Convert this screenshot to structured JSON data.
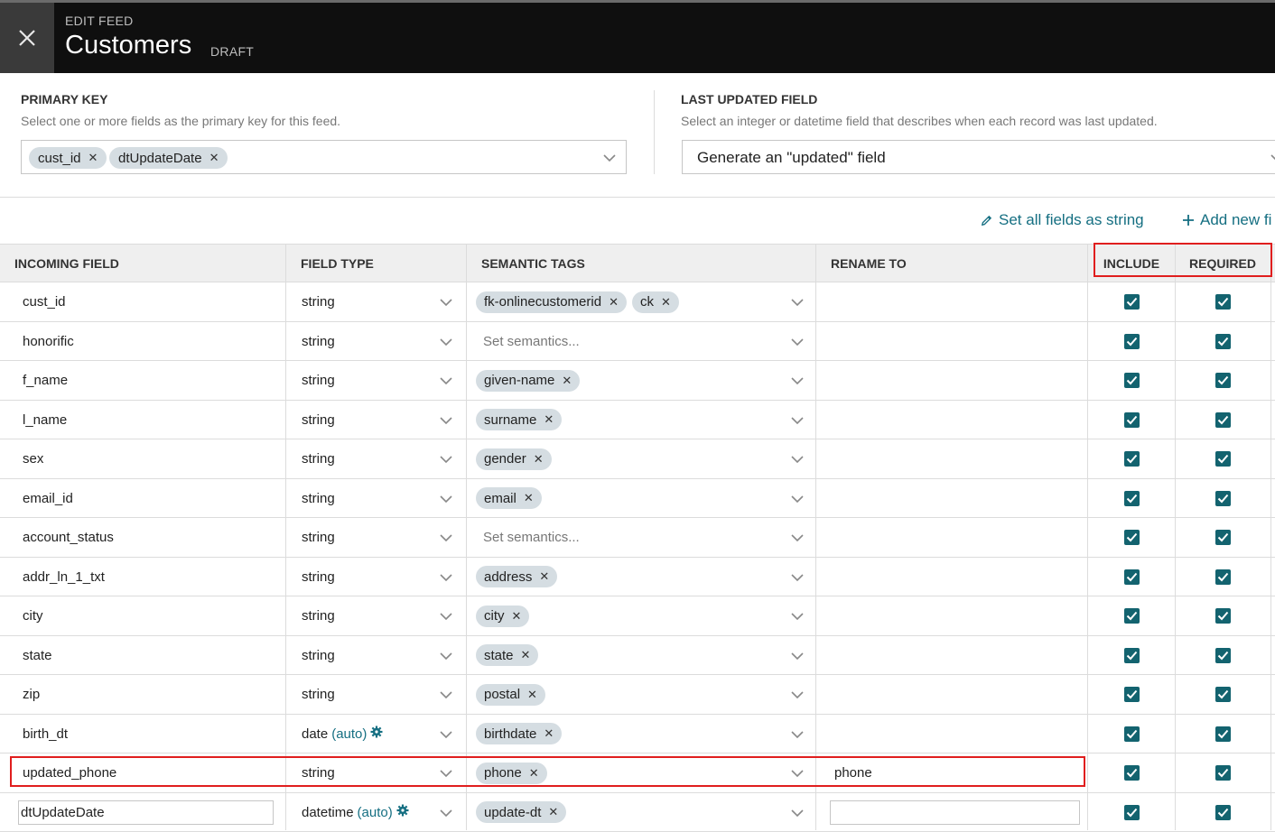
{
  "header": {
    "eyebrow": "EDIT FEED",
    "title": "Customers",
    "status": "DRAFT"
  },
  "primary_key": {
    "label": "PRIMARY KEY",
    "help": "Select one or more fields as the primary key for this feed.",
    "selected": [
      "cust_id",
      "dtUpdateDate"
    ]
  },
  "last_updated": {
    "label": "LAST UPDATED FIELD",
    "help": "Select an integer or datetime field that describes when each record was last updated.",
    "value": "Generate an \"updated\" field"
  },
  "actions": {
    "set_all_string": "Set all fields as string",
    "add_new": "Add new fi"
  },
  "table": {
    "columns": [
      "INCOMING FIELD",
      "FIELD TYPE",
      "SEMANTIC TAGS",
      "RENAME TO",
      "INCLUDE",
      "REQUIRED"
    ],
    "semantic_placeholder": "Set semantics...",
    "rows": [
      {
        "field": "cust_id",
        "type": "string",
        "auto": "",
        "tags": [
          "fk-onlinecustomerid",
          "ck"
        ],
        "rename": "",
        "include": true,
        "required": true
      },
      {
        "field": "honorific",
        "type": "string",
        "auto": "",
        "tags": [],
        "rename": "",
        "include": true,
        "required": true
      },
      {
        "field": "f_name",
        "type": "string",
        "auto": "",
        "tags": [
          "given-name"
        ],
        "rename": "",
        "include": true,
        "required": true
      },
      {
        "field": "l_name",
        "type": "string",
        "auto": "",
        "tags": [
          "surname"
        ],
        "rename": "",
        "include": true,
        "required": true
      },
      {
        "field": "sex",
        "type": "string",
        "auto": "",
        "tags": [
          "gender"
        ],
        "rename": "",
        "include": true,
        "required": true
      },
      {
        "field": "email_id",
        "type": "string",
        "auto": "",
        "tags": [
          "email"
        ],
        "rename": "",
        "include": true,
        "required": true
      },
      {
        "field": "account_status",
        "type": "string",
        "auto": "",
        "tags": [],
        "rename": "",
        "include": true,
        "required": true
      },
      {
        "field": "addr_ln_1_txt",
        "type": "string",
        "auto": "",
        "tags": [
          "address"
        ],
        "rename": "",
        "include": true,
        "required": true
      },
      {
        "field": "city",
        "type": "string",
        "auto": "",
        "tags": [
          "city"
        ],
        "rename": "",
        "include": true,
        "required": true
      },
      {
        "field": "state",
        "type": "string",
        "auto": "",
        "tags": [
          "state"
        ],
        "rename": "",
        "include": true,
        "required": true
      },
      {
        "field": "zip",
        "type": "string",
        "auto": "",
        "tags": [
          "postal"
        ],
        "rename": "",
        "include": true,
        "required": true
      },
      {
        "field": "birth_dt",
        "type": "date",
        "auto": "(auto)",
        "tags": [
          "birthdate"
        ],
        "rename": "",
        "include": true,
        "required": true
      },
      {
        "field": "updated_phone",
        "type": "string",
        "auto": "",
        "tags": [
          "phone"
        ],
        "rename": "phone",
        "include": true,
        "required": true
      },
      {
        "field": "dtUpdateDate",
        "type": "datetime",
        "auto": "(auto)",
        "tags": [
          "update-dt"
        ],
        "rename": "",
        "include": true,
        "required": true,
        "editable": true
      }
    ]
  },
  "icons": {
    "close": "close-icon",
    "chevron": "chevron-down-icon",
    "pencil": "pencil-icon",
    "plus": "plus-icon",
    "gear": "gear-icon",
    "check": "checkbox-checked-icon"
  },
  "colors": {
    "accent": "#156f82",
    "checkbox": "#13636f",
    "highlight": "#e01e1e",
    "topbar": "#0f0f0f"
  }
}
